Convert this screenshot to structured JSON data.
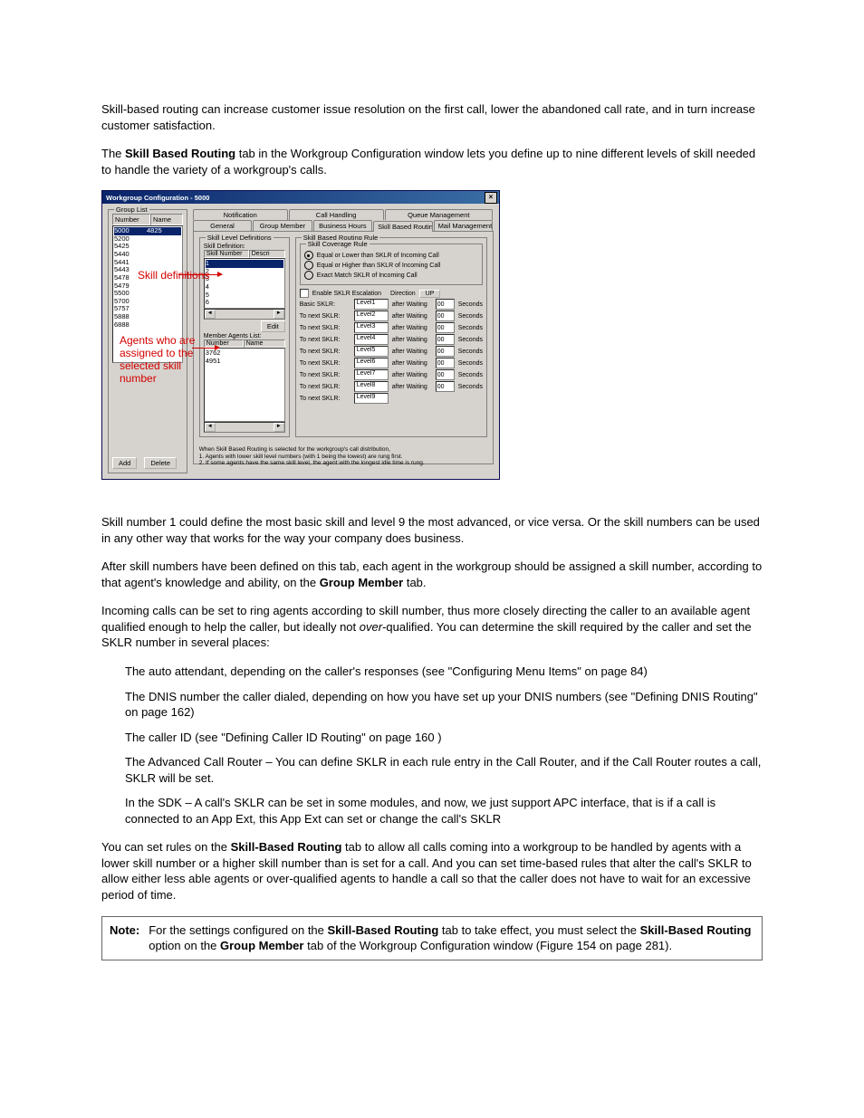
{
  "para1": "Skill-based routing can increase customer issue resolution on the first call, lower the abandoned call rate, and in turn increase customer satisfaction.",
  "para2_a": "The ",
  "para2_b": "Skill Based Routing",
  "para2_c": " tab in the Workgroup Configuration window lets you define up to nine different levels of skill needed to handle the variety of a workgroup's calls.",
  "para3": "Skill number 1 could define the most basic skill and level 9 the most advanced, or vice versa. Or the skill numbers can be used in any other way that works for the way your company does business.",
  "para4_a": "After skill numbers have been defined on this tab, each agent in the workgroup should be assigned a skill number, according to that agent's knowledge and ability, on the ",
  "para4_b": "Group Member",
  "para4_c": " tab.",
  "para5_a": "Incoming calls can be set to ring agents according to skill number, thus more closely directing the caller to an available agent qualified enough to help the caller, but ideally not ",
  "para5_b": "over",
  "para5_c": "-qualified. You can determine the skill required by the caller and set the SKLR number in several places:",
  "bullets": [
    "The auto attendant, depending on the caller's responses (see \"Configuring Menu Items\" on page 84)",
    "The DNIS number the caller dialed, depending on how you have set up your DNIS numbers (see \"Defining DNIS Routing\" on page 162)",
    "The caller ID (see \"Defining Caller ID Routing\" on page 160 )",
    "The Advanced Call Router – You can define SKLR in each rule entry in the Call Router, and if the Call Router routes a call, SKLR will be set.",
    "In the SDK – A call's SKLR can be set in some modules, and now, we just support APC interface, that is if a call is connected to an App Ext, this App Ext can set or change the call's SKLR"
  ],
  "para6_a": "You can set rules on the ",
  "para6_b": "Skill-Based Routing",
  "para6_c": " tab to allow all calls coming into a workgroup to be handled by agents with a lower skill number or a higher skill number than is set for a call. And you can set time-based rules that alter the call's SKLR to allow either less able agents or over-qualified agents to handle a call so that the caller does not have to wait for an excessive period of time.",
  "note": {
    "label": "Note:",
    "a": "For the settings configured on the ",
    "b": "Skill-Based Routing",
    "c": " tab to take effect, you must select the ",
    "d": "Skill-Based Routing",
    "e": " option on the ",
    "f": "Group Member",
    "g": " tab of the Workgroup Configuration window (",
    "h": "Figure 154 on page 281",
    "i": ")."
  },
  "win": {
    "title": "Workgroup Configuration - 5000",
    "group_list": "Group List",
    "num": "Number",
    "name": "Name",
    "rows": [
      "5000",
      "5200",
      "5425",
      "5440",
      "5441",
      "5443",
      "5478",
      "5479",
      "5500",
      "5700",
      "5757",
      "5888",
      "6888"
    ],
    "row0_name": "4825",
    "add": "Add",
    "delete": "Delete",
    "tabs_top": [
      "Notification",
      "Call Handling",
      "Queue Management"
    ],
    "tabs_bottom": [
      "General",
      "Group Member",
      "Business Hours",
      "Skill Based Routing",
      "Mail Management"
    ],
    "sld": "Skill Level Definitions",
    "sdef": "Skill Definition:",
    "skill_num": "Skill Number",
    "descr": "Descri",
    "skills": [
      "1",
      "2",
      "3",
      "4",
      "5",
      "6"
    ],
    "mal": "Member Agents List:",
    "mem_num": "Number",
    "mem_name": "Name",
    "members": [
      "3762",
      "4951"
    ],
    "edit": "Edit",
    "sbrr": "Skill Based Routing Rule",
    "scr": "Skill Coverage Rule",
    "r1": "Equal or Lower than SKLR of Incoming Call",
    "r2": "Equal or Higher than SKLR of Incoming Call",
    "r3": "Exact Match SKLR of Incoming Call",
    "enable": "Enable SKLR Escalation",
    "direction": "Direction",
    "up": "UP",
    "basic": "Basic SKLR:",
    "tonext": "To next SKLR:",
    "levels": [
      "Level1",
      "Level2",
      "Level3",
      "Level4",
      "Level5",
      "Level6",
      "Level7",
      "Level8",
      "Level9"
    ],
    "after": "after Waiting",
    "sec": "Seconds",
    "spin": "00",
    "foot0": "When Skill Based Routing is selected for the workgroup's call distribution,",
    "foot1": "1. Agents with lower skill level numbers (with 1 being the lowest) are rung first.",
    "foot2": "2. If some agents have the same skill level, the agent with the longest idle time is rung."
  },
  "ann": {
    "a1": "Skill definitions",
    "a2": "Agents who are assigned to the selected skill number"
  }
}
